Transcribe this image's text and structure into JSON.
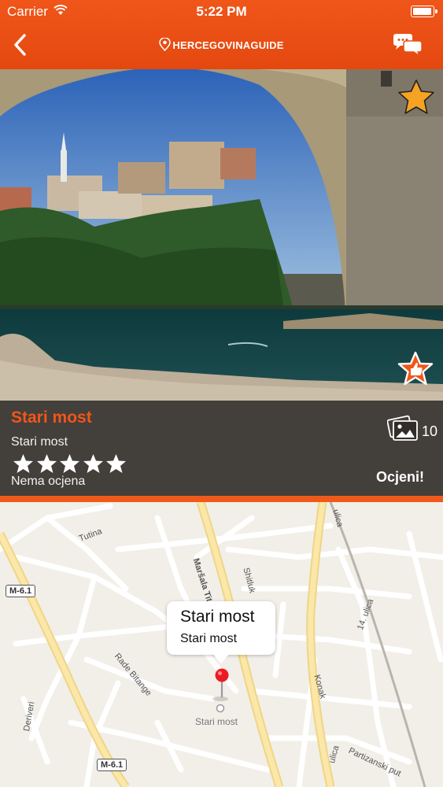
{
  "status_bar": {
    "carrier": "Carrier",
    "time": "5:22 PM"
  },
  "header": {
    "brand": "HERCEGOVINAGUIDE",
    "back_icon": "chevron-left-icon",
    "chat_icon": "speech-bubbles-icon"
  },
  "place": {
    "title": "Stari most",
    "subtitle": "Stari most",
    "rating_label": "Nema ocjena",
    "stars": 5,
    "stars_filled": 0,
    "gallery_count": "10",
    "rate_button": "Ocjeni!"
  },
  "map": {
    "callout_title": "Stari most",
    "callout_subtitle": "Stari most",
    "pin_label": "Stari most",
    "road_labels": {
      "m61_top": "M-6.1",
      "m61_bottom": "M-6.1",
      "tutina": "Tutina",
      "marsala_tita": "Maršala Tita",
      "rade_bitange": "Rade Bitange",
      "konak": "Konak",
      "ulica14": "14. ulica",
      "deriveri": "Deriveri",
      "partizanski": "Partizanski put",
      "ulica_top": "ulica",
      "ulica_bottom": "ulica",
      "shitluk": "Shitluk"
    }
  },
  "colors": {
    "accent": "#f0561a",
    "star_gold": "#f6a323"
  }
}
